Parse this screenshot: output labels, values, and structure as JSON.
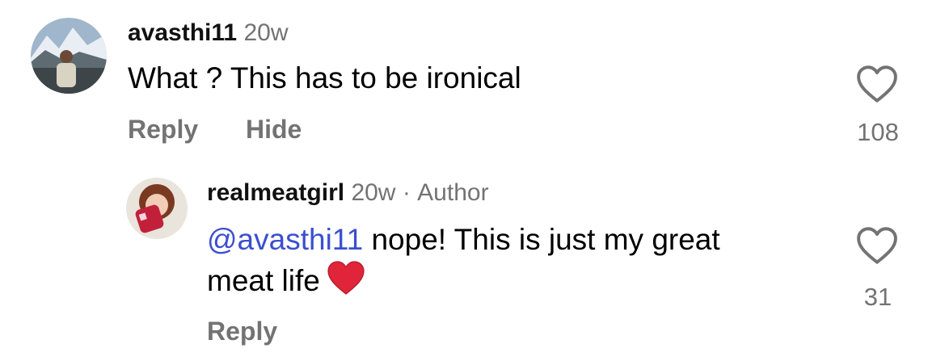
{
  "comments": [
    {
      "username": "avasthi11",
      "time": "20w",
      "text": "What ? This has to be ironical",
      "actions": {
        "reply": "Reply",
        "hide": "Hide"
      },
      "like_count": "108",
      "avatar_icon": "profile-photo-mountains",
      "like_icon": "heart-outline-icon"
    },
    {
      "username": "realmeatgirl",
      "time": "20w",
      "separator": "·",
      "author_badge": "Author",
      "mention": "@avasthi11",
      "text_line1": " nope! This is just my great",
      "text_line2": "meat life",
      "emoji": "red-heart-emoji",
      "actions": {
        "reply": "Reply"
      },
      "like_count": "31",
      "avatar_icon": "profile-photo-meat",
      "like_icon": "heart-outline-icon"
    }
  ],
  "colors": {
    "text": "#000000",
    "muted": "#737373",
    "mention": "#3b4fd0",
    "emoji_heart": "#e0243a"
  }
}
